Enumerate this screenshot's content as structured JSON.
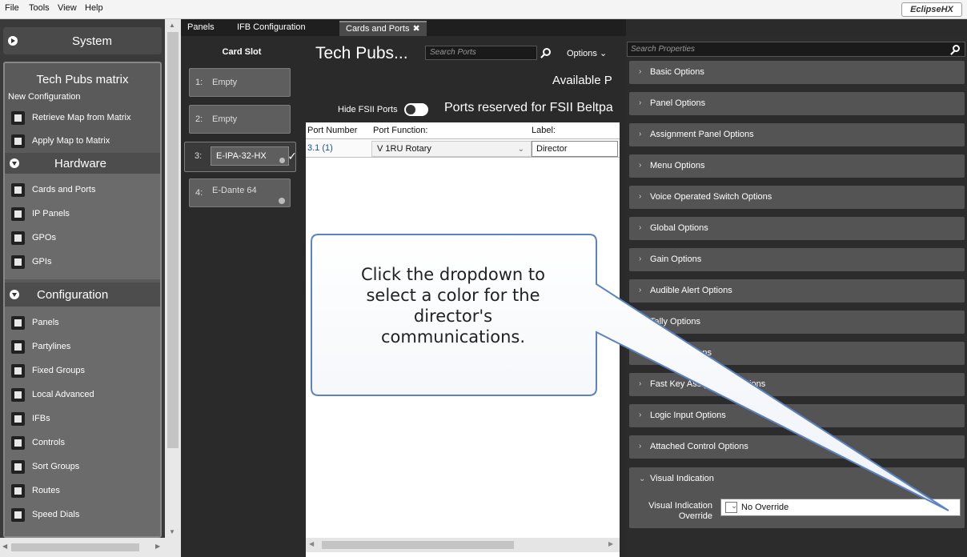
{
  "menu": [
    "File",
    "Tools",
    "View",
    "Help"
  ],
  "brand": "EclipseHX",
  "sidebar": {
    "system_label": "System",
    "matrix_title": "Tech Pubs matrix",
    "matrix_sub": "New Configuration",
    "actions": [
      "Retrieve Map from Matrix",
      "Apply Map to Matrix"
    ],
    "hardware_label": "Hardware",
    "hardware_items": [
      "Cards and Ports",
      "IP Panels",
      "GPOs",
      "GPIs"
    ],
    "configuration_label": "Configuration",
    "configuration_items": [
      "Panels",
      "Partylines",
      "Fixed Groups",
      "Local Advanced",
      "IFBs",
      "Controls",
      "Sort Groups",
      "Routes",
      "Speed Dials"
    ]
  },
  "tabs": [
    "Panels",
    "IFB Configuration",
    "Cards and Ports"
  ],
  "cards": {
    "header": "Card Slot",
    "slots": [
      {
        "num": "1:",
        "name": "Empty"
      },
      {
        "num": "2:",
        "name": "Empty"
      },
      {
        "num": "3:",
        "name": "E-IPA-32-HX"
      },
      {
        "num": "4:",
        "name": "E-Dante 64"
      }
    ]
  },
  "ports": {
    "title": "Tech Pubs...",
    "search_placeholder": "Search Ports",
    "options_label": "Options",
    "available_label": "Available P",
    "hide_fsii_label": "Hide FSII Ports",
    "reserved_label": "Ports reserved for FSII Beltpa",
    "columns": [
      "Port Number",
      "Port Function:",
      "Label:"
    ],
    "row": {
      "port_number": "3.1 (1)",
      "port_function": "V 1RU Rotary",
      "label": "Director"
    }
  },
  "properties": {
    "search_placeholder": "Search Properties",
    "sections": [
      "Basic Options",
      "Panel Options",
      "Assignment Panel Options",
      "Menu Options",
      "Voice Operated Switch Options",
      "Global Options",
      "Gain Options",
      "Audible Alert Options",
      "Tally Options",
      "Display Options",
      "Fast Key Assignment Options",
      "Logic Input Options",
      "Attached Control Options"
    ],
    "visual_indication": {
      "header": "Visual Indication",
      "label_line1": "Visual Indication",
      "label_line2": "Override",
      "value": "No Override"
    }
  },
  "callout": {
    "lines": [
      "Click the dropdown to",
      "select a color for the",
      "director's",
      "communications."
    ]
  }
}
